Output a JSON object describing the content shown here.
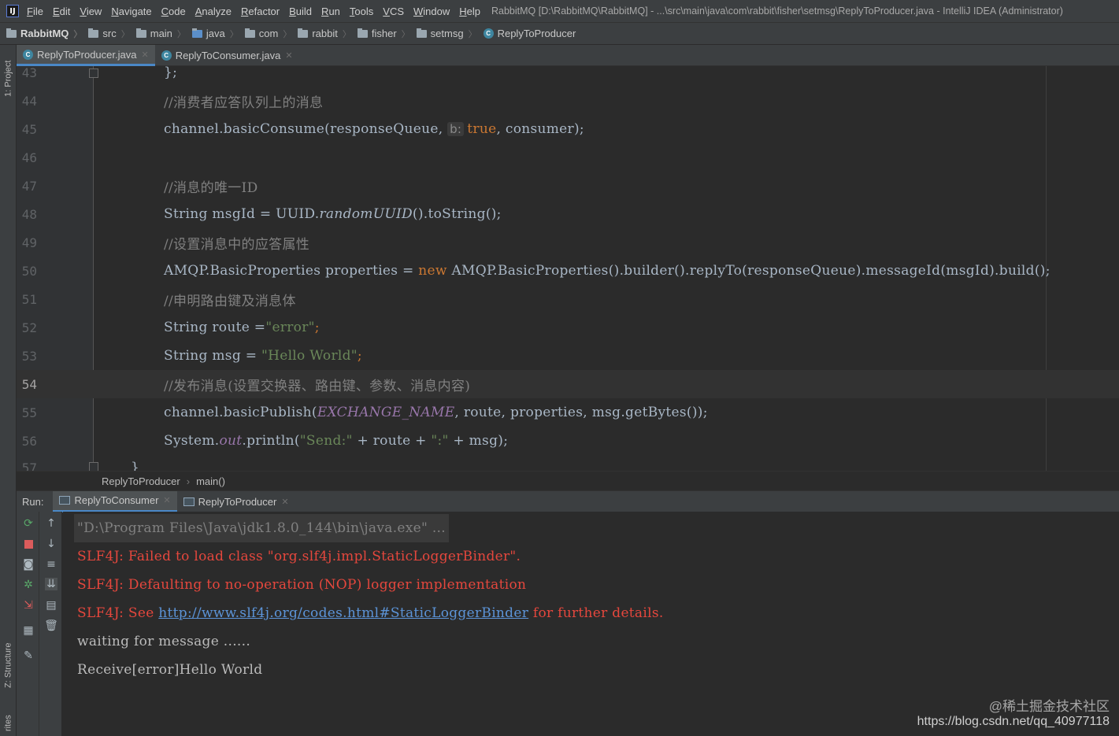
{
  "menubar": {
    "logo": "IJ",
    "items": [
      "File",
      "Edit",
      "View",
      "Navigate",
      "Code",
      "Analyze",
      "Refactor",
      "Build",
      "Run",
      "Tools",
      "VCS",
      "Window",
      "Help"
    ],
    "window_title": "RabbitMQ [D:\\RabbitMQ\\RabbitMQ] - ...\\src\\main\\java\\com\\rabbit\\fisher\\setmsg\\ReplyToProducer.java - IntelliJ IDEA (Administrator)"
  },
  "navbar": {
    "project": "RabbitMQ",
    "crumbs": [
      "src",
      "main",
      "java",
      "com",
      "rabbit",
      "fisher",
      "setmsg"
    ],
    "class_name": "ReplyToProducer"
  },
  "left_strip": {
    "project_tab": "1: Project",
    "structure_tab": "Z: Structure",
    "favorites_tab": "rites"
  },
  "editor_tabs": [
    {
      "label": "ReplyToProducer.java",
      "active": true
    },
    {
      "label": "ReplyToConsumer.java",
      "active": false
    }
  ],
  "editor": {
    "line_numbers": [
      "43",
      "44",
      "45",
      "46",
      "47",
      "48",
      "49",
      "50",
      "51",
      "52",
      "53",
      "54",
      "55",
      "56",
      "57"
    ],
    "current_line": "54",
    "code": {
      "l43": "};",
      "l44": "//消费者应答队列上的消息",
      "l45_a": "channel.basicConsume(responseQueue, ",
      "l45_hint": "b:",
      "l45_kw": "true",
      "l45_b": ", consumer);",
      "l47": "//消息的唯一ID",
      "l48_a": "String msgId = UUID.",
      "l48_method": "randomUUID",
      "l48_b": "().toString();",
      "l49": "//设置消息中的应答属性",
      "l50_a": "AMQP.BasicProperties properties = ",
      "l50_kw": "new",
      "l50_b": " AMQP.BasicProperties().builder().replyTo(responseQueue).messageId(msgId).build();",
      "l51": "//申明路由键及消息体",
      "l52_a": "String route =",
      "l52_str": "\"error\"",
      "l52_b": ";",
      "l53_a": "String msg = ",
      "l53_str": "\"Hello World\"",
      "l53_b": ";",
      "l54": "//发布消息(设置交换器、路由键、参数、消息内容)",
      "l55_a": "channel.basicPublish(",
      "l55_static": "EXCHANGE_NAME",
      "l55_b": ", route, properties, msg.getBytes());",
      "l56_a": "System.",
      "l56_static": "out",
      "l56_b": ".println(",
      "l56_str1": "\"Send:\"",
      "l56_c": " + route + ",
      "l56_str2": "\":\"",
      "l56_d": " + msg);",
      "l57": "}"
    }
  },
  "code_crumbs": [
    "ReplyToProducer",
    "main()"
  ],
  "run": {
    "label": "Run:",
    "tabs": [
      {
        "label": "ReplyToConsumer",
        "active": true
      },
      {
        "label": "ReplyToProducer",
        "active": false
      }
    ]
  },
  "console": {
    "cmd": "\"D:\\Program Files\\Java\\jdk1.8.0_144\\bin\\java.exe\" ...",
    "err1": "SLF4J: Failed to load class \"org.slf4j.impl.StaticLoggerBinder\".",
    "err2": "SLF4J: Defaulting to no-operation (NOP) logger implementation",
    "err3_a": "SLF4J: See ",
    "err3_link": "http://www.slf4j.org/codes.html#StaticLoggerBinder",
    "err3_b": " for further details.",
    "out1": "waiting for message ......",
    "out2": "Receive[error]Hello World"
  },
  "watermark": {
    "line1": "@稀土掘金技术社区",
    "line2": "https://blog.csdn.net/qq_40977118"
  },
  "colors": {
    "background": "#2b2b2b",
    "keyword": "#cc7832",
    "string": "#6a8759",
    "comment": "#808080",
    "error_text": "#e5473d",
    "link": "#5c94d8"
  }
}
